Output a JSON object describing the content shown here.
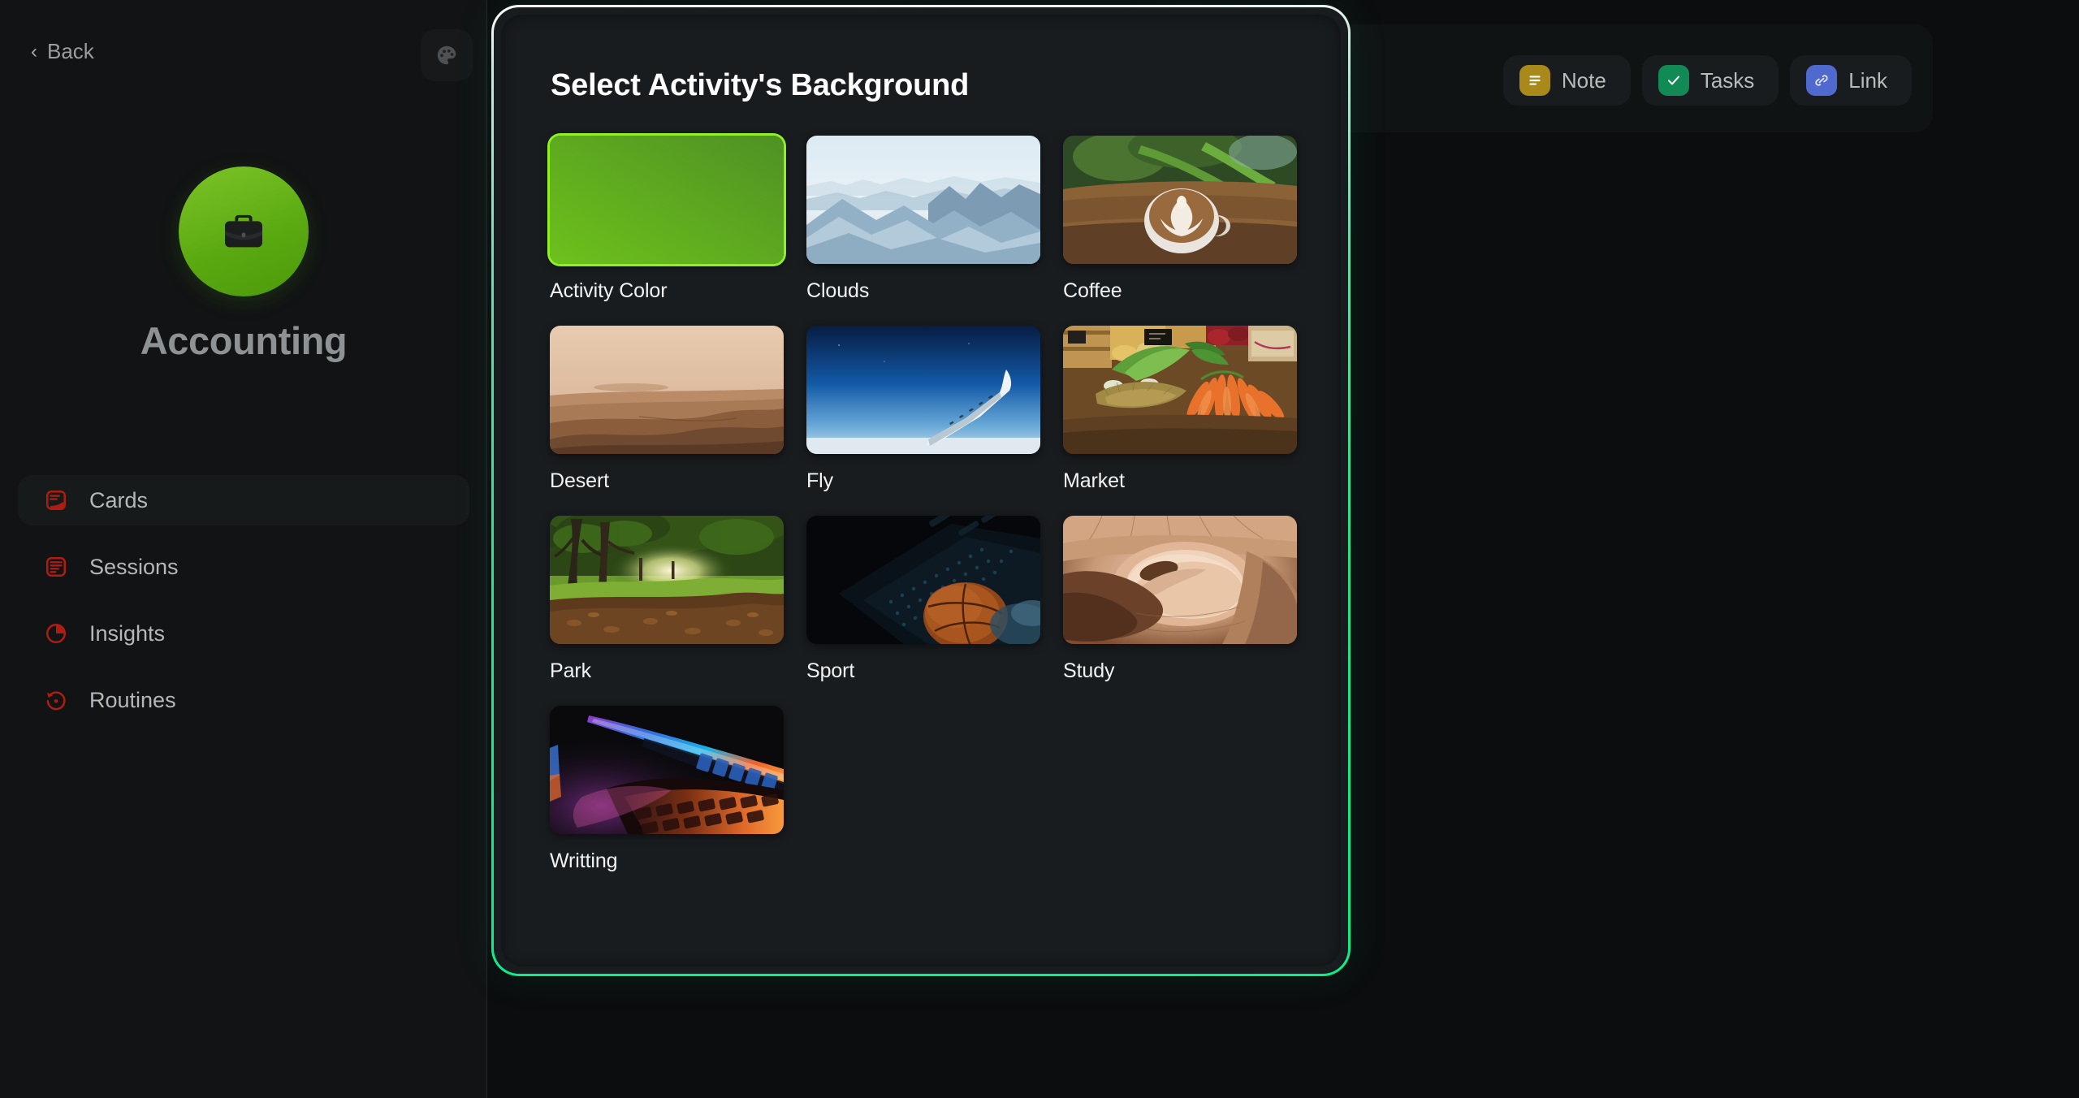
{
  "sidebar": {
    "back_label": "Back",
    "back_icon": "chevron-left-icon",
    "palette_icon": "palette-icon",
    "activity_icon": "briefcase-icon",
    "activity_name": "Accounting",
    "activity_color": "#63b018",
    "nav": [
      {
        "label": "Cards",
        "icon": "cards-icon",
        "active": true,
        "color": "#b01c12"
      },
      {
        "label": "Sessions",
        "icon": "sessions-icon",
        "active": false,
        "color": "#b01c12"
      },
      {
        "label": "Insights",
        "icon": "pie-chart-icon",
        "active": false,
        "color": "#b01c12"
      },
      {
        "label": "Routines",
        "icon": "history-icon",
        "active": false,
        "color": "#b01c12"
      }
    ]
  },
  "toolbar": {
    "chips": [
      {
        "label": "Note",
        "icon": "note-icon",
        "color": "#a8891a"
      },
      {
        "label": "Tasks",
        "icon": "check-icon",
        "color": "#128a55"
      },
      {
        "label": "Link",
        "icon": "link-icon",
        "color": "#4f69cf"
      }
    ]
  },
  "modal": {
    "title": "Select Activity's Background",
    "border_gradient_from": "#ffffff",
    "border_gradient_to": "#0bef8a",
    "backgrounds": [
      {
        "label": "Activity Color",
        "kind": "color",
        "selected": true,
        "color": "#63b018"
      },
      {
        "label": "Clouds",
        "kind": "image",
        "selected": false
      },
      {
        "label": "Coffee",
        "kind": "image",
        "selected": false
      },
      {
        "label": "Desert",
        "kind": "image",
        "selected": false
      },
      {
        "label": "Fly",
        "kind": "image",
        "selected": false
      },
      {
        "label": "Market",
        "kind": "image",
        "selected": false
      },
      {
        "label": "Park",
        "kind": "image",
        "selected": false
      },
      {
        "label": "Sport",
        "kind": "image",
        "selected": false
      },
      {
        "label": "Study",
        "kind": "image",
        "selected": false
      },
      {
        "label": "Writting",
        "kind": "image",
        "selected": false
      }
    ]
  }
}
